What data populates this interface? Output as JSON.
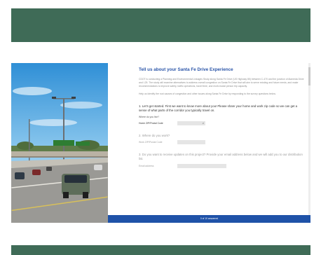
{
  "colors": {
    "band": "#3f6b57",
    "title": "#2b55a8",
    "progress_bar": "#1f52a8"
  },
  "survey": {
    "title": "Tell us about your Santa Fe Drive Experience",
    "intro": "CDOT is conducting a Planning and Environmental Linkages Study along Santa Fe Drive (US Highway 85) between C-470 and the junction of Alameda Drive and I-25. The study will examine alternatives to address overall congestion on Santa Fe Drive that will aim to serve existing and future needs, and make recommendations to improve safety, traffic operations, travel time, and multi-modal person trip capacity.",
    "help_text": "Help us identify the root causes of congestion and other issues along Santa Fe Drive by responding to the survey questions below.",
    "q1": "1. Let's get started. First we want to know more about you! Please share your home and work zip code so we can get a sense of what parts of the corridor you typically travel on.",
    "q1_sub": "Where do you live?",
    "home_label": "Home ZIP/Postal Code",
    "q2": "2. Where do you work?",
    "work_label": "Work ZIP/Postal Code",
    "q3": "3. Do you want to receive updates on this project? Provide your email address below and we will add you to our distribution list.",
    "email_label": "Email address",
    "progress_text": "0 of 10 answered",
    "progress_fraction": 0
  }
}
